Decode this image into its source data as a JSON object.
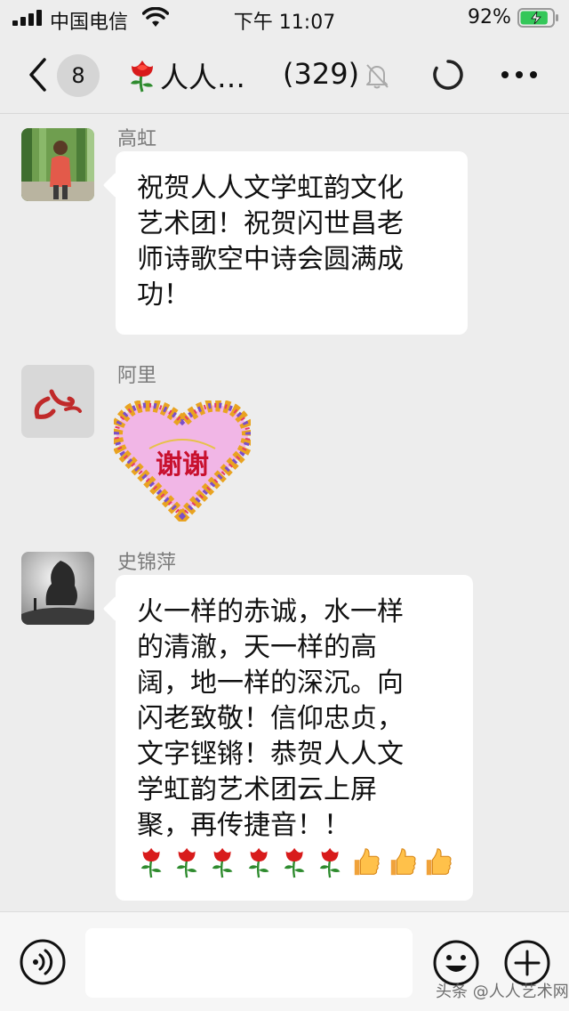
{
  "status_bar": {
    "carrier": "中国电信",
    "time": "下午 11:07",
    "battery_percent": "92%",
    "battery_level": 0.92
  },
  "nav": {
    "unread_count": "8",
    "title": "人人…",
    "member_count": "(329)"
  },
  "messages": [
    {
      "sender": "高虹",
      "text": "祝贺人人文学虹韵文化\n艺术团！祝贺闪世昌老\n师诗歌空中诗会圆满成\n功！"
    },
    {
      "sender": "阿里",
      "sticker_text": "谢谢"
    },
    {
      "sender": "史锦萍",
      "text": "火一样的赤诚，水一样\n的清澈，天一样的高\n阔，地一样的深沉。向\n闪老致敬！信仰忠贞，\n文字铿锵！恭贺人人文\n学虹韵艺术团云上屏\n聚，再传捷音！！",
      "emoji": [
        "rose-icon",
        "rose-icon",
        "rose-icon",
        "rose-icon",
        "rose-icon",
        "rose-icon",
        "thumbs-up-icon",
        "thumbs-up-icon",
        "thumbs-up-icon"
      ]
    }
  ],
  "watermark": "头条 @人人艺术网",
  "colors": {
    "background": "#ededed",
    "bubble": "#ffffff",
    "sender_name": "#7b7b7b",
    "battery_green": "#34c759"
  }
}
